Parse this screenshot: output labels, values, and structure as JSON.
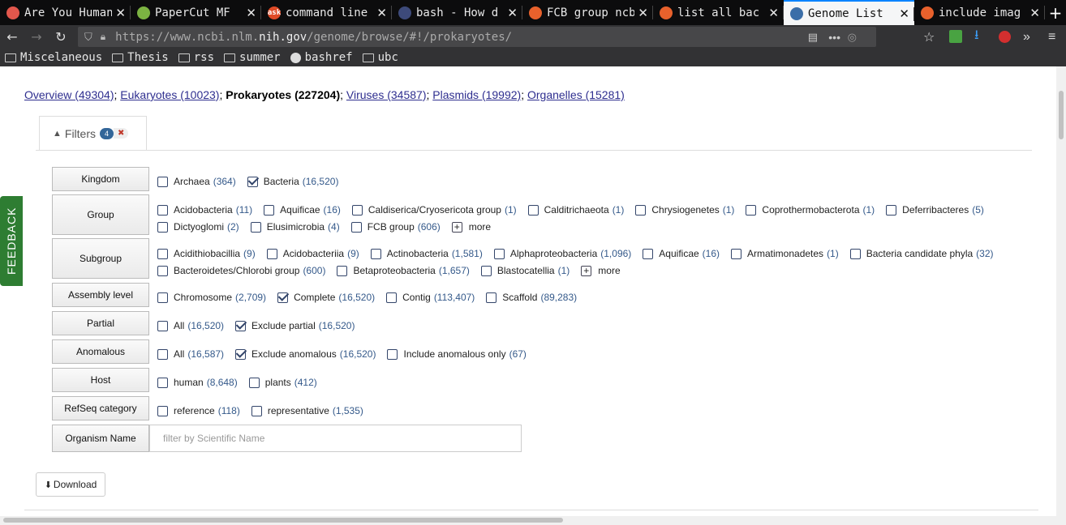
{
  "tabs": [
    {
      "title": "Are You Human",
      "fav_color": "#e2574c",
      "fav_glyph": ""
    },
    {
      "title": "PaperCut MF",
      "fav_color": "#7cb342",
      "fav_glyph": ""
    },
    {
      "title": "command line",
      "fav_color": "#e04a26",
      "fav_glyph": "ask"
    },
    {
      "title": "bash - How d",
      "fav_color": "#3d4a7a",
      "fav_glyph": ""
    },
    {
      "title": "FCB group ncb",
      "fav_color": "#e8612c",
      "fav_glyph": ""
    },
    {
      "title": "list all bac",
      "fav_color": "#e8612c",
      "fav_glyph": ""
    },
    {
      "title": "Genome List",
      "fav_color": "#3b6ea8",
      "fav_glyph": "",
      "active": true
    },
    {
      "title": "include imag",
      "fav_color": "#e8612c",
      "fav_glyph": ""
    }
  ],
  "newtab": "+",
  "url": {
    "prefix": "https://www.ncbi.nlm.",
    "domain": "nih.gov",
    "path": "/genome/browse/#!/prokaryotes/"
  },
  "bookmarks": [
    {
      "label": "Miscelaneous"
    },
    {
      "label": "Thesis"
    },
    {
      "label": "rss"
    },
    {
      "label": "summer"
    },
    {
      "label": "bashref"
    },
    {
      "label": "ubc"
    }
  ],
  "crumbs": {
    "overview": "Overview (49304)",
    "eukaryotes": "Eukaryotes (10023)",
    "prokaryotes": "Prokaryotes (227204)",
    "viruses": "Viruses (34587)",
    "plasmids": "Plasmids (19992)",
    "organelles": "Organelles (15281)",
    "sep": ";"
  },
  "filters": {
    "label": "Filters",
    "count": "4",
    "clear": "✖"
  },
  "feedback": "FEEDBACK",
  "rows": {
    "kingdom": {
      "label": "Kingdom",
      "items": [
        {
          "name": "Archaea",
          "count": "(364)",
          "checked": false
        },
        {
          "name": "Bacteria",
          "count": "(16,520)",
          "checked": true
        }
      ]
    },
    "group": {
      "label": "Group",
      "line1": [
        {
          "name": "Acidobacteria",
          "count": "(11)"
        },
        {
          "name": "Aquificae",
          "count": "(16)"
        },
        {
          "name": "Caldiserica/Cryosericota group",
          "count": "(1)"
        },
        {
          "name": "Calditrichaeota",
          "count": "(1)"
        },
        {
          "name": "Chrysiogenetes",
          "count": "(1)"
        },
        {
          "name": "Coprothermobacterota",
          "count": "(1)"
        },
        {
          "name": "Deferribacteres",
          "count": "(5)"
        }
      ],
      "line2": [
        {
          "name": "Dictyoglomi",
          "count": "(2)"
        },
        {
          "name": "Elusimicrobia",
          "count": "(4)"
        },
        {
          "name": "FCB group",
          "count": "(606)"
        }
      ],
      "more": "more"
    },
    "subgroup": {
      "label": "Subgroup",
      "line1": [
        {
          "name": "Acidithiobacillia",
          "count": "(9)"
        },
        {
          "name": "Acidobacteriia",
          "count": "(9)"
        },
        {
          "name": "Actinobacteria",
          "count": "(1,581)"
        },
        {
          "name": "Alphaproteobacteria",
          "count": "(1,096)"
        },
        {
          "name": "Aquificae",
          "count": "(16)"
        },
        {
          "name": "Armatimonadetes",
          "count": "(1)"
        },
        {
          "name": "Bacteria candidate phyla",
          "count": "(32)"
        }
      ],
      "line2": [
        {
          "name": "Bacteroidetes/Chlorobi group",
          "count": "(600)"
        },
        {
          "name": "Betaproteobacteria",
          "count": "(1,657)"
        },
        {
          "name": "Blastocatellia",
          "count": "(1)"
        }
      ],
      "more": "more"
    },
    "assembly": {
      "label": "Assembly level",
      "items": [
        {
          "name": "Chromosome",
          "count": "(2,709)",
          "checked": false
        },
        {
          "name": "Complete",
          "count": "(16,520)",
          "checked": true
        },
        {
          "name": "Contig",
          "count": "(113,407)",
          "checked": false
        },
        {
          "name": "Scaffold",
          "count": "(89,283)",
          "checked": false
        }
      ]
    },
    "partial": {
      "label": "Partial",
      "items": [
        {
          "name": "All",
          "count": "(16,520)",
          "checked": false
        },
        {
          "name": "Exclude partial",
          "count": "(16,520)",
          "checked": true
        }
      ]
    },
    "anomalous": {
      "label": "Anomalous",
      "items": [
        {
          "name": "All",
          "count": "(16,587)",
          "checked": false
        },
        {
          "name": "Exclude anomalous",
          "count": "(16,520)",
          "checked": true
        },
        {
          "name": "Include anomalous only",
          "count": "(67)",
          "checked": false
        }
      ]
    },
    "host": {
      "label": "Host",
      "items": [
        {
          "name": "human",
          "count": "(8,648)",
          "checked": false
        },
        {
          "name": "plants",
          "count": "(412)",
          "checked": false
        }
      ]
    },
    "refseq": {
      "label": "RefSeq category",
      "items": [
        {
          "name": "reference",
          "count": "(118)",
          "checked": false
        },
        {
          "name": "representative",
          "count": "(1,535)",
          "checked": false
        }
      ]
    },
    "organism": {
      "label": "Organism Name",
      "placeholder": "filter by Scientific Name"
    }
  },
  "download": "Download"
}
